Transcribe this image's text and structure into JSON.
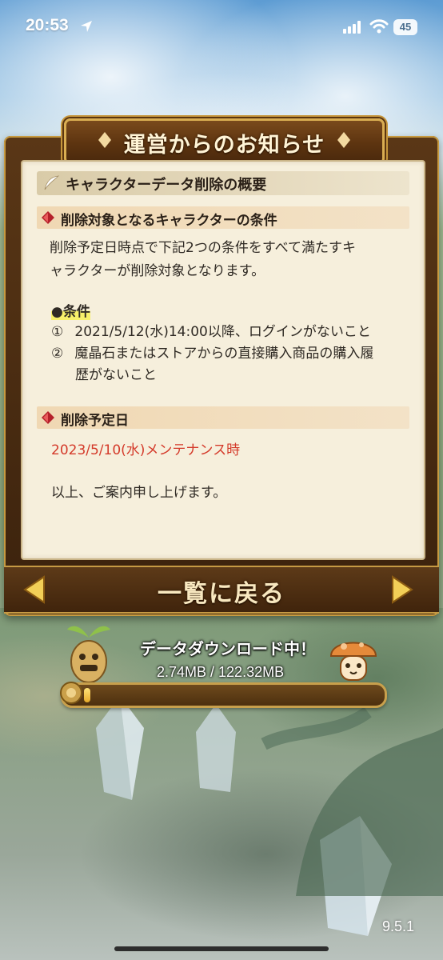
{
  "status_bar": {
    "time": "20:53",
    "battery": "45"
  },
  "dialog": {
    "title": "運営からのお知らせ",
    "main_heading": "キャラクターデータ削除の概要",
    "section1_heading": "削除対象となるキャラクターの条件",
    "section1_body": [
      "削除予定日時点で下記2つの条件をすべて満たすキ",
      "ャラクターが削除対象となります。"
    ],
    "conditions_label": "●条件",
    "conditions": [
      {
        "num": "①",
        "text": "2021/5/12(水)14:00以降、ログインがないこと",
        "cont": ""
      },
      {
        "num": "②",
        "text": "魔晶石またはストアからの直接購入商品の購入履",
        "cont": "歴がないこと"
      }
    ],
    "section2_heading": "削除予定日",
    "deletion_date": "2023/5/10(水)メンテナンス時",
    "closing": "以上、ご案内申し上げます。"
  },
  "nav": {
    "back_label": "一覧に戻る"
  },
  "download": {
    "status": "データダウンロード中！",
    "size": "2.74MB / 122.32MB",
    "progress": 0.022
  },
  "version": "9.5.1",
  "colors": {
    "accent_red": "#d43a2a",
    "frame_gold": "#c8a04c",
    "panel_bg": "#f6efdc"
  }
}
